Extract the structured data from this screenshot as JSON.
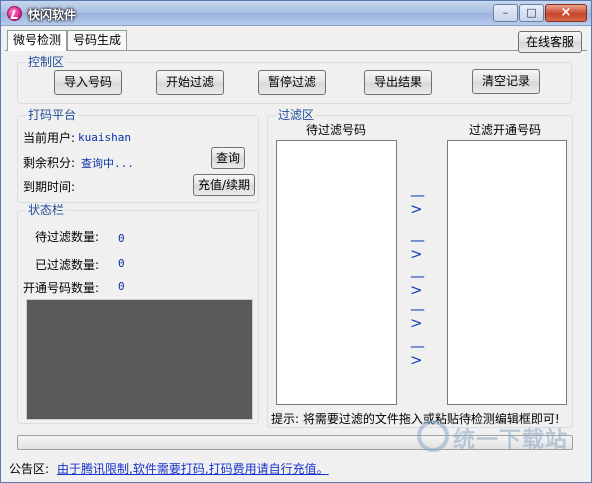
{
  "window": {
    "title": "快闪软件",
    "controls": {
      "minimize": "–",
      "maximize": "□",
      "close": "×"
    }
  },
  "tabs": [
    {
      "label": "微号检测",
      "active": true
    },
    {
      "label": "号码生成",
      "active": false
    }
  ],
  "online_service_label": "在线客服",
  "control_area": {
    "title": "控制区",
    "buttons": [
      "导入号码",
      "开始过滤",
      "暂停过滤",
      "导出结果",
      "清空记录"
    ]
  },
  "platform": {
    "title": "打码平台",
    "current_user_label": "当前用户:",
    "current_user_value": "kuaishan",
    "remaining_points_label": "剩余积分:",
    "remaining_points_value": "查询中...",
    "expire_label": "到期时间:",
    "query_button": "查询",
    "recharge_button": "充值/续期"
  },
  "status": {
    "title": "状态栏",
    "pending_label": "待过滤数量:",
    "pending_value": "0",
    "filtered_label": "已过滤数量:",
    "filtered_value": "0",
    "opened_label": "开通号码数量:",
    "opened_value": "0"
  },
  "filter_area": {
    "title": "过滤区",
    "left_header": "待过滤号码",
    "right_header": "过滤开通号码",
    "arrow": "—>",
    "hint": "提示: 将需要过滤的文件拖入或粘贴待检测编辑框即可!"
  },
  "notice": {
    "label": "公告区:",
    "text": "由于腾讯限制,软件需要打码,打码费用请自行充值。"
  },
  "watermark": {
    "text": "统一下载站"
  },
  "colors": {
    "group_title": "#1f4b99",
    "value_text": "#0b30a8",
    "link": "#1a33cc",
    "dark_panel": "#595959"
  }
}
